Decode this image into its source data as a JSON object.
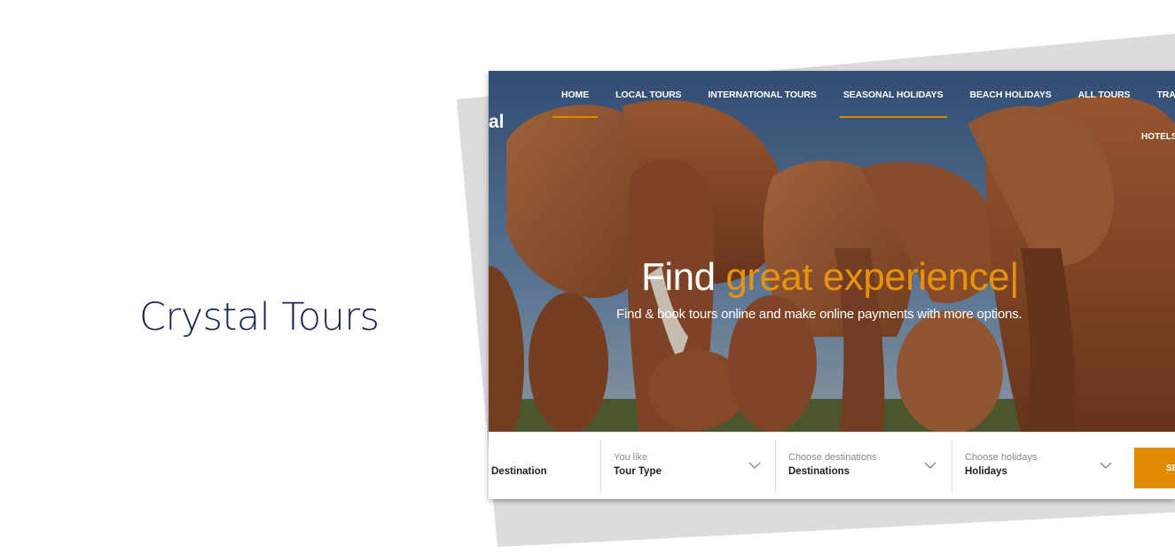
{
  "brand": {
    "title": "Crystal Tours"
  },
  "site": {
    "logo_fragment": "al",
    "nav": {
      "items": [
        {
          "label": "HOME"
        },
        {
          "label": "LOCAL TOURS"
        },
        {
          "label": "INTERNATIONAL TOURS"
        },
        {
          "label": "SEASONAL HOLIDAYS"
        },
        {
          "label": "BEACH HOLIDAYS"
        },
        {
          "label": "ALL TOURS"
        },
        {
          "label": "TRA"
        }
      ],
      "second_row": "HOTELS"
    },
    "hero": {
      "headline_plain": "Find ",
      "headline_accent": "great experience",
      "cursor": "|",
      "subline": "Find & book tours online and make online payments with more options."
    },
    "search": {
      "destination_value": "Destination",
      "tour_type_label": "You like",
      "tour_type_value": "Tour Type",
      "destinations_label": "Choose destinations",
      "destinations_value": "Destinations",
      "holidays_label": "Choose holidays",
      "holidays_value": "Holidays",
      "button_label": "SEARCH"
    },
    "colors": {
      "accent": "#e08a00",
      "brand_text": "#15264f"
    }
  }
}
